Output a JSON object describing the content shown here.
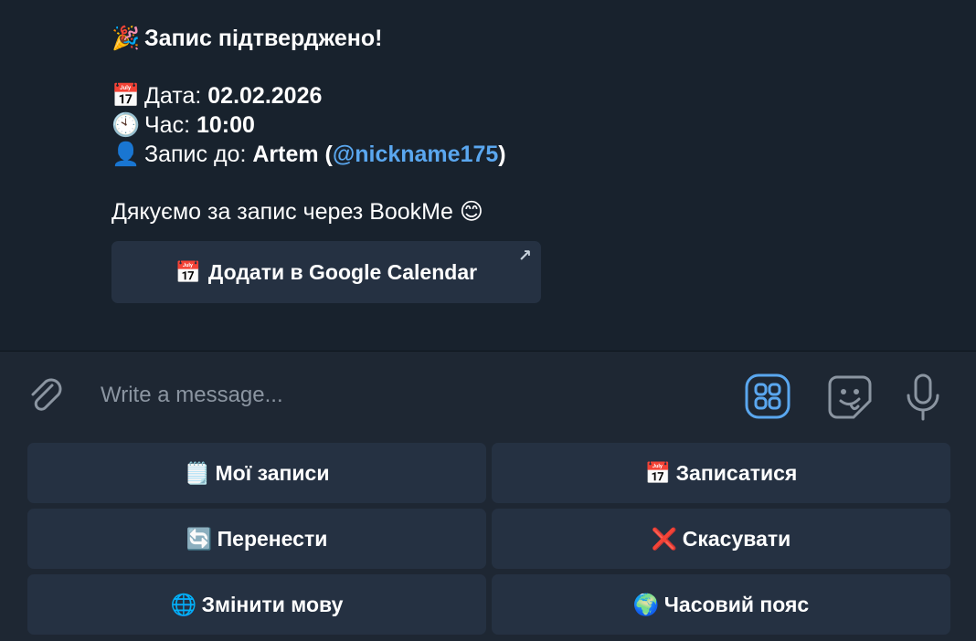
{
  "message": {
    "header_emoji": "🎉",
    "header_text": "Запис підтверджено!",
    "date_emoji": "📅",
    "date_label": "Дата: ",
    "date_value": "02.02.2026",
    "time_emoji": "🕙",
    "time_label": "Час: ",
    "time_value": "10:00",
    "master_emoji": "👤",
    "master_label": "Запис до: ",
    "master_name": "Artem (",
    "master_username": "@nickname175",
    "master_close": ")",
    "thanks_text": "Дякуємо за запис через BookMe ",
    "thanks_emoji": "😊"
  },
  "inline_button": {
    "emoji": "📅",
    "label": "Додати в Google Calendar",
    "ext_icon": "↗"
  },
  "composer": {
    "placeholder": "Write a message..."
  },
  "keyboard": {
    "my_bookings": {
      "emoji": "🗒️",
      "label": "Мої записи"
    },
    "book": {
      "emoji": "📅",
      "label": "Записатися"
    },
    "reschedule": {
      "emoji": "🔄",
      "label": "Перенести"
    },
    "cancel": {
      "emoji": "❌",
      "label": "Скасувати"
    },
    "language": {
      "emoji": "🌐",
      "label": "Змінити мову"
    },
    "timezone": {
      "emoji": "🌍",
      "label": "Часовий пояс"
    }
  },
  "colors": {
    "background": "#18222d",
    "button": "#253142",
    "link": "#5aa7ef",
    "accent": "#5aa7ef"
  }
}
